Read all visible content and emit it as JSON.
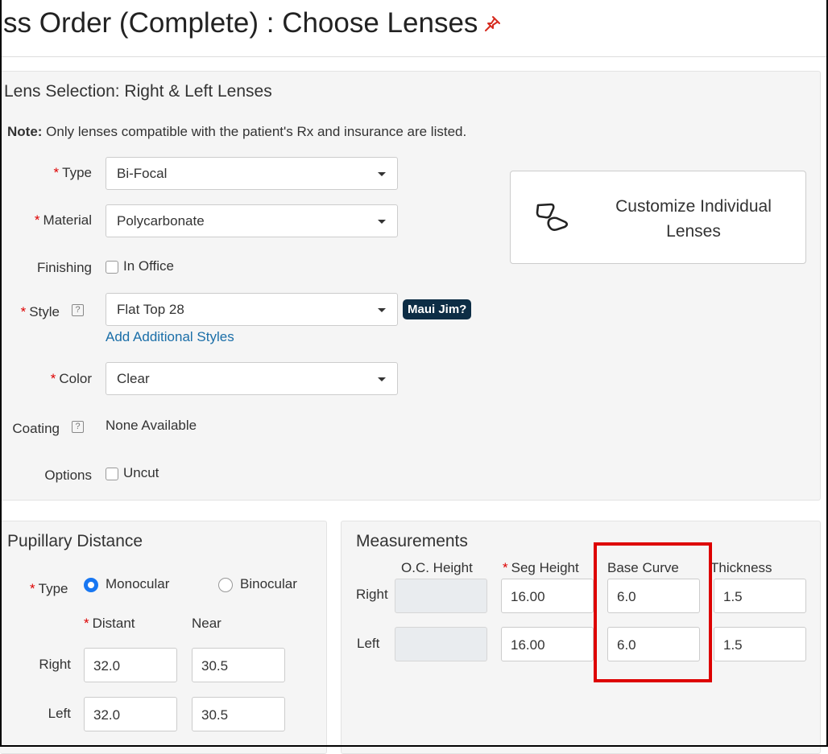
{
  "page": {
    "title": "ss Order (Complete) : Choose Lenses",
    "pin_icon": "pushpin-icon"
  },
  "lens_selection": {
    "title": "Lens Selection: Right & Left Lenses",
    "note_bold": "Note:",
    "note_text": " Only lenses compatible with the patient's Rx and insurance are listed.",
    "type": {
      "label": "Type",
      "required": "*",
      "value": "Bi-Focal"
    },
    "material": {
      "label": "Material",
      "required": "*",
      "value": "Polycarbonate"
    },
    "finishing": {
      "label": "Finishing",
      "checkbox_label": "In Office"
    },
    "style": {
      "label": "Style",
      "required": "*",
      "help": "?",
      "value": "Flat Top 28",
      "badge": "Maui Jim?",
      "add_link": "Add Additional Styles"
    },
    "color": {
      "label": "Color",
      "required": "*",
      "value": "Clear"
    },
    "coating": {
      "label": "Coating",
      "help": "?",
      "value": "None Available"
    },
    "options": {
      "label": "Options",
      "checkbox_label": "Uncut"
    },
    "customize_button": {
      "line1": "Customize Individual",
      "line2": "Lenses",
      "icon": "lenses-icon"
    }
  },
  "pupillary_distance": {
    "title": "Pupillary Distance",
    "type_label": "Type",
    "required": "*",
    "monocular": "Monocular",
    "binocular": "Binocular",
    "selected": "Monocular",
    "distant_label": "Distant",
    "near_label": "Near",
    "right_label": "Right",
    "left_label": "Left",
    "right_distant": "32.0",
    "right_near": "30.5",
    "left_distant": "32.0",
    "left_near": "30.5"
  },
  "measurements": {
    "title": "Measurements",
    "oc_height": "O.C. Height",
    "seg_height": "Seg Height",
    "seg_required": "*",
    "base_curve": "Base Curve",
    "thickness": "Thickness",
    "right_label": "Right",
    "left_label": "Left",
    "right": {
      "oc": "",
      "seg": "16.00",
      "base": "6.0",
      "thick": "1.5"
    },
    "left": {
      "oc": "",
      "seg": "16.00",
      "base": "6.0",
      "thick": "1.5"
    }
  },
  "colors": {
    "required": "#dd0000",
    "link": "#1a6ea8",
    "badge_bg": "#0d2d45",
    "radio_on": "#1877f2",
    "highlight": "#dd0000"
  }
}
